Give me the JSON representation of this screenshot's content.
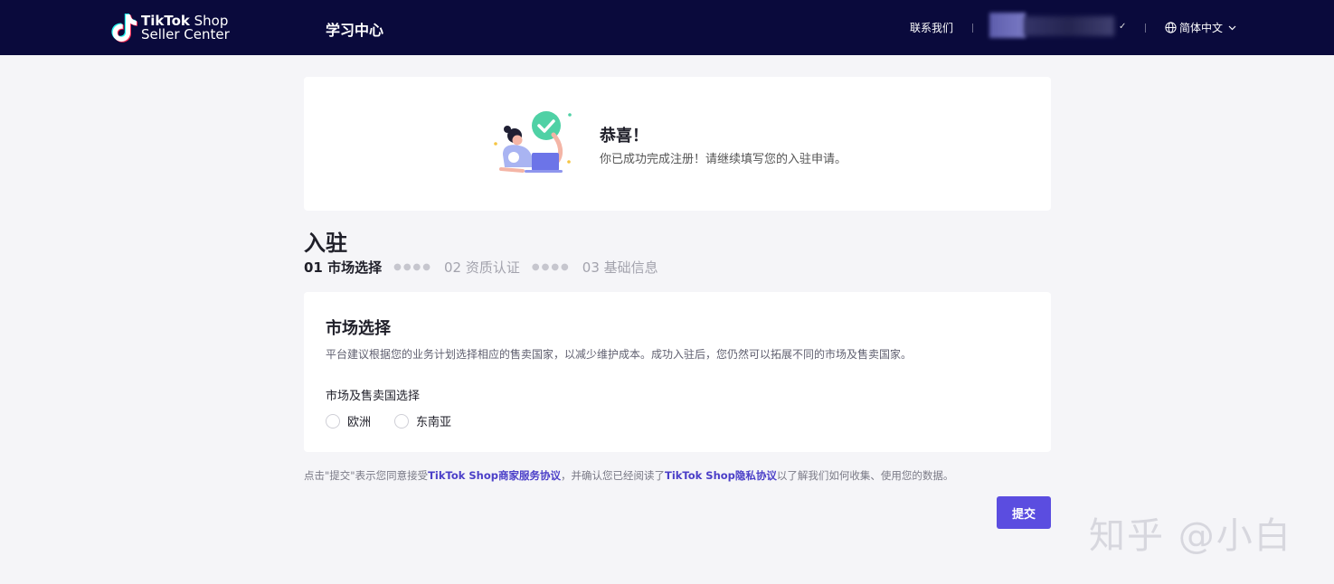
{
  "header": {
    "logo_brand": "TikTok",
    "logo_shop": " Shop",
    "logo_sub": "Seller Center",
    "learning_center": "学习中心",
    "contact_us": "联系我们",
    "account_caret": "✓",
    "language": "简体中文"
  },
  "congrats": {
    "title": "恭喜！",
    "description": "你已成功完成注册！请继续填写您的入驻申请。"
  },
  "page": {
    "title": "入驻",
    "steps": [
      {
        "label": "01 市场选择",
        "active": true
      },
      {
        "label": "02 资质认证",
        "active": false
      },
      {
        "label": "03 基础信息",
        "active": false
      }
    ]
  },
  "market": {
    "title": "市场选择",
    "description": "平台建议根据您的业务计划选择相应的售卖国家，以减少维护成本。成功入驻后，您仍然可以拓展不同的市场及售卖国家。",
    "field_label": "市场及售卖国选择",
    "options": [
      "欧洲",
      "东南亚"
    ]
  },
  "agreement": {
    "prefix": "点击\"提交\"表示您同意接受",
    "link1_brand": "TikTok Shop",
    "link1_name": "商家服务协议",
    "middle": "，并确认您已经阅读了",
    "link2_brand": "TikTok Shop",
    "link2_name": "隐私协议",
    "suffix": "以了解我们如何收集、使用您的数据。"
  },
  "submit_label": "提交",
  "watermark": "知乎 @小白",
  "colors": {
    "header_bg": "#0a0a3c",
    "accent": "#5b4de0",
    "link": "#4b3fc8",
    "success": "#4fd1a5"
  }
}
